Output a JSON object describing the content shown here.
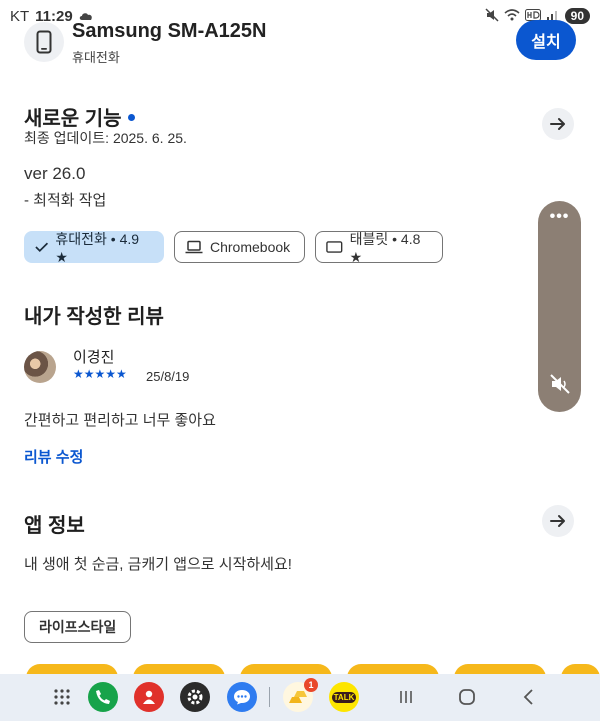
{
  "status_bar": {
    "carrier": "KT",
    "time": "11:29",
    "battery": "90"
  },
  "device": {
    "name": "Samsung SM-A125N",
    "type": "휴대전화",
    "install_label": "설치"
  },
  "whats_new": {
    "title": "새로운 기능",
    "updated": "최종 업데이트: 2025. 6. 25.",
    "version": "ver 26.0",
    "notes": "- 최적화 작업"
  },
  "device_chips": [
    {
      "label": "휴대전화 • 4.9 ★",
      "selected": true,
      "icon": "check-icon"
    },
    {
      "label": "Chromebook",
      "selected": false,
      "icon": "laptop-icon"
    },
    {
      "label": "태블릿 • 4.8 ★",
      "selected": false,
      "icon": "tablet-icon"
    }
  ],
  "my_review": {
    "title": "내가 작성한 리뷰",
    "reviewer": "이경진",
    "stars": "★★★★★",
    "date": "25/8/19",
    "text": "간편하고 편리하고 너무 좋아요",
    "edit_label": "리뷰 수정"
  },
  "app_info": {
    "title": "앱 정보",
    "description": "내 생애 첫 순금, 금캐기 앱으로 시작하세요!",
    "category": "라이프스타일"
  },
  "taskbar": {
    "badge_count": "1",
    "kakao_label": "TALK"
  },
  "colors": {
    "accent": "#0b57d0",
    "chip_selected": "#c7e0f8",
    "tile_yellow": "#f6b81b",
    "volume_pill": "#8c7f74"
  }
}
